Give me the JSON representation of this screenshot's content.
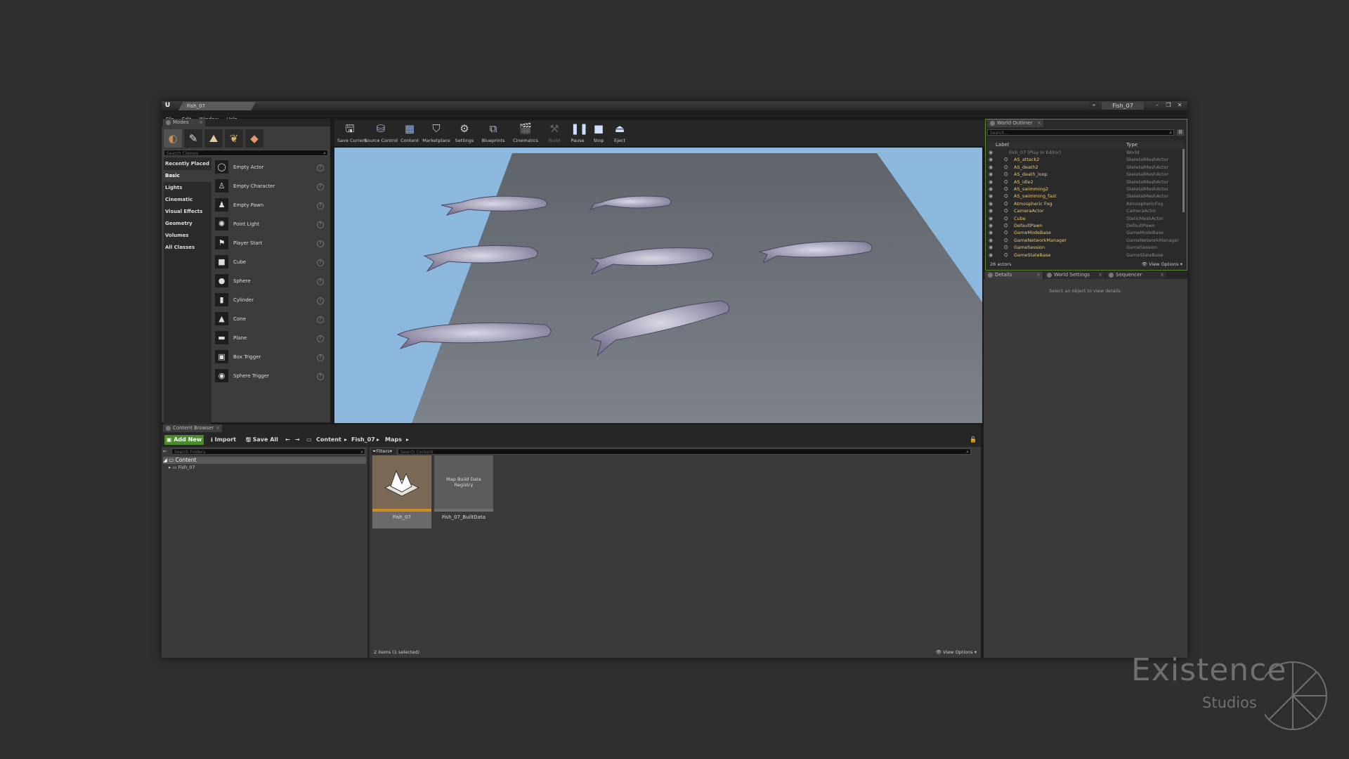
{
  "window": {
    "tab_title": "Fish_07",
    "project_name": "Fish_07",
    "logo": "U"
  },
  "menu": [
    "File",
    "Edit",
    "Window",
    "Help"
  ],
  "modes": {
    "tab_label": "Modes",
    "search_placeholder": "Search Classes",
    "categories": [
      "Recently Placed",
      "Basic",
      "Lights",
      "Cinematic",
      "Visual Effects",
      "Geometry",
      "Volumes",
      "All Classes"
    ],
    "selected_category": "Basic",
    "items": [
      {
        "label": "Empty Actor",
        "icon": "◯"
      },
      {
        "label": "Empty Character",
        "icon": "♙"
      },
      {
        "label": "Empty Pawn",
        "icon": "♟"
      },
      {
        "label": "Point Light",
        "icon": "✺"
      },
      {
        "label": "Player Start",
        "icon": "⚑"
      },
      {
        "label": "Cube",
        "icon": "■"
      },
      {
        "label": "Sphere",
        "icon": "●"
      },
      {
        "label": "Cylinder",
        "icon": "▮"
      },
      {
        "label": "Cone",
        "icon": "▲"
      },
      {
        "label": "Plane",
        "icon": "▬"
      },
      {
        "label": "Box Trigger",
        "icon": "▣"
      },
      {
        "label": "Sphere Trigger",
        "icon": "◉"
      }
    ]
  },
  "toolbar": {
    "save_current": "Save Current",
    "source_control": "Source Control",
    "content": "Content",
    "marketplace": "Marketplace",
    "settings": "Settings",
    "blueprints": "Blueprints",
    "cinematics": "Cinematics",
    "build": "Build",
    "pause": "Pause",
    "stop": "Stop",
    "eject": "Eject"
  },
  "outliner": {
    "tab_label": "World Outliner",
    "search_placeholder": "Search...",
    "col_label": "Label",
    "col_type": "Type",
    "rows": [
      {
        "label": "Fish_07 (Play In Editor)",
        "type": "World",
        "world": true
      },
      {
        "label": "AS_attack2",
        "type": "SkeletalMeshActor"
      },
      {
        "label": "AS_death2",
        "type": "SkeletalMeshActor"
      },
      {
        "label": "AS_death_loop",
        "type": "SkeletalMeshActor"
      },
      {
        "label": "AS_idle2",
        "type": "SkeletalMeshActor"
      },
      {
        "label": "AS_swimming2",
        "type": "SkeletalMeshActor"
      },
      {
        "label": "AS_swimming_fast",
        "type": "SkeletalMeshActor"
      },
      {
        "label": "Atmospheric Fog",
        "type": "AtmosphericFog"
      },
      {
        "label": "CameraActor",
        "type": "CameraActor"
      },
      {
        "label": "Cube",
        "type": "StaticMeshActor"
      },
      {
        "label": "DefaultPawn",
        "type": "DefaultPawn"
      },
      {
        "label": "GameModeBase",
        "type": "GameModeBase"
      },
      {
        "label": "GameNetworkManager",
        "type": "GameNetworkManager"
      },
      {
        "label": "GameSession",
        "type": "GameSession"
      },
      {
        "label": "GameStateBase",
        "type": "GameStateBase"
      }
    ],
    "actor_count": "26 actors",
    "view_options": "View Options"
  },
  "details": {
    "tab_details": "Details",
    "tab_world_settings": "World Settings",
    "tab_sequencer": "Sequencer",
    "empty_message": "Select an object to view details."
  },
  "content_browser": {
    "tab_label": "Content Browser",
    "add_new": "Add New",
    "import": "Import",
    "save_all": "Save All",
    "breadcrumb": [
      "Content",
      "Fish_07",
      "Maps"
    ],
    "folder_search_placeholder": "Search Folders",
    "filters": "Filters",
    "content_search_placeholder": "Search Content",
    "tree": [
      "Content",
      "Fish_07"
    ],
    "assets": [
      {
        "name": "Fish_07",
        "thumb_label": ""
      },
      {
        "name": "Fish_07_BuiltData",
        "thumb_label": "Map Build Data Registry"
      }
    ],
    "status": "2 items (1 selected)",
    "view_options": "View Options"
  },
  "watermark": {
    "title": "Existence",
    "subtitle": "Studios"
  },
  "colors": {
    "accent_green": "#4c8b2b",
    "selection_orange": "#d08a1f",
    "sky": "#8cb8de",
    "floor": "#6f747b"
  }
}
